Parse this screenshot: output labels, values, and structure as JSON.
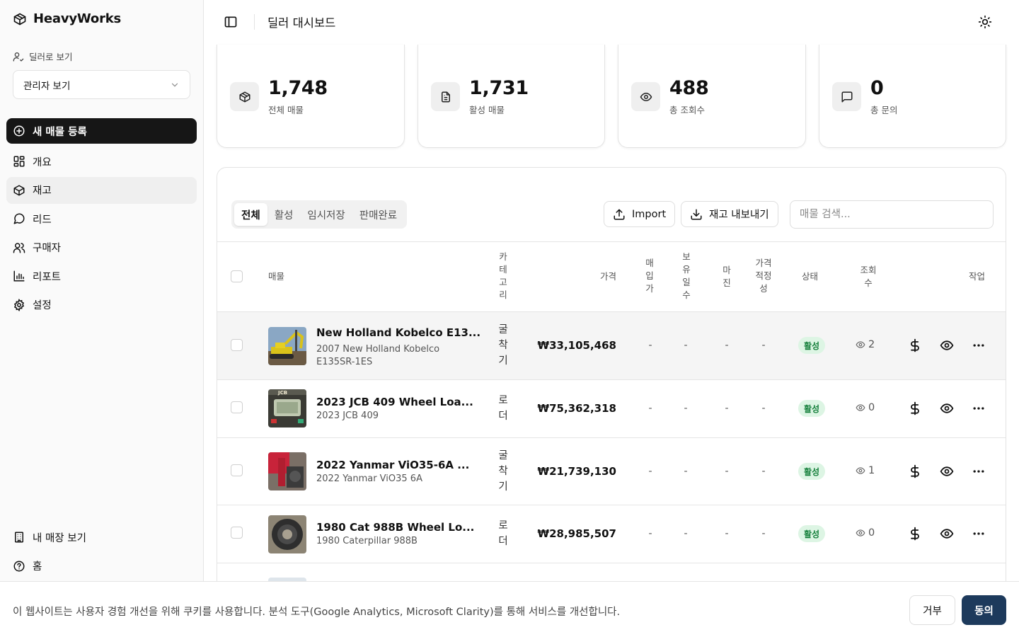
{
  "brand": {
    "name": "HeavyWorks",
    "icon": "package-icon"
  },
  "sidebar": {
    "view_as_label": "딜러로 보기",
    "view_select": "관리자 보기",
    "new_listing": "새 매물 등록",
    "items": [
      {
        "label": "개요",
        "icon": "layout-grid-icon"
      },
      {
        "label": "재고",
        "icon": "package-icon"
      },
      {
        "label": "리드",
        "icon": "message-circle-icon"
      },
      {
        "label": "구매자",
        "icon": "users-icon"
      },
      {
        "label": "리포트",
        "icon": "bar-chart-icon"
      },
      {
        "label": "설정",
        "icon": "gear-icon"
      }
    ],
    "bottom": [
      {
        "label": "내 매장 보기",
        "icon": "building-icon"
      },
      {
        "label": "홈",
        "icon": "help-circle-icon"
      }
    ]
  },
  "header": {
    "title": "딜러 대시보드"
  },
  "stats": [
    {
      "value": "1,748",
      "label": "전체 매물",
      "icon": "package-icon"
    },
    {
      "value": "1,731",
      "label": "활성 매물",
      "icon": "file-text-icon"
    },
    {
      "value": "488",
      "label": "총 조회수",
      "icon": "eye-icon"
    },
    {
      "value": "0",
      "label": "총 문의",
      "icon": "message-square-icon"
    }
  ],
  "inventory": {
    "tabs": [
      "전체",
      "활성",
      "임시저장",
      "판매완료"
    ],
    "import_label": "Import",
    "export_label": "재고 내보내기",
    "search_placeholder": "매물 검색...",
    "columns": {
      "listing": "매물",
      "category": "카테고리",
      "price": "가격",
      "cost": "매입가",
      "days": "보유일수",
      "margin": "마진",
      "fairness": "가격적정성",
      "status": "상태",
      "views": "조회수",
      "actions": "작업"
    },
    "rows": [
      {
        "title": "New Holland Kobelco E13...",
        "subtitle": "2007 New Holland Kobelco E135SR-1ES",
        "category": "굴착기",
        "price": "₩33,105,468",
        "cost": "-",
        "days": "-",
        "margin": "-",
        "fairness": "-",
        "status": "활성",
        "views": "2"
      },
      {
        "title": "2023 JCB 409 Wheel Loa...",
        "subtitle": "2023 JCB 409",
        "category": "로더",
        "price": "₩75,362,318",
        "cost": "-",
        "days": "-",
        "margin": "-",
        "fairness": "-",
        "status": "활성",
        "views": "0"
      },
      {
        "title": "2022 Yanmar ViO35-6A ...",
        "subtitle": "2022 Yanmar ViO35 6A",
        "category": "굴착기",
        "price": "₩21,739,130",
        "cost": "-",
        "days": "-",
        "margin": "-",
        "fairness": "-",
        "status": "활성",
        "views": "1"
      },
      {
        "title": "1980 Cat 988B Wheel Lo...",
        "subtitle": "1980 Caterpillar 988B",
        "category": "로더",
        "price": "₩28,985,507",
        "cost": "-",
        "days": "-",
        "margin": "-",
        "fairness": "-",
        "status": "활성",
        "views": "0"
      }
    ]
  },
  "cookie": {
    "text": "이 웹사이트는 사용자 경험 개선을 위해 쿠키를 사용합니다. 분석 도구(Google Analytics, Microsoft Clarity)를 통해 서비스를 개선합니다.",
    "reject": "거부",
    "accept": "동의"
  },
  "colors": {
    "accent_dark": "#161616",
    "status_active_bg": "#ddf5e4",
    "status_active_text": "#16803c",
    "accept_button": "#1d3a5c"
  }
}
